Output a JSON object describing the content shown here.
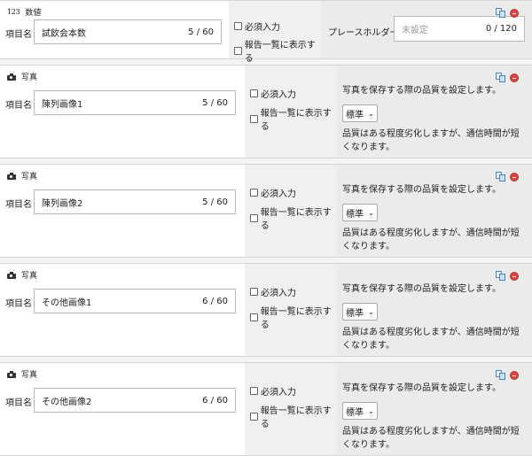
{
  "fields": [
    {
      "kind": "number",
      "type_glyph": "123",
      "type_label": "数値",
      "name_label": "項目名",
      "name_value": "試飲会本数",
      "name_count": "5 / 60",
      "required_label": "必須入力",
      "show_in_list_label": "報告一覧に表示する",
      "placeholder_label": "プレースホルダー",
      "placeholder_hint": "未設定",
      "placeholder_count": "0 / 120"
    },
    {
      "kind": "photo",
      "type_label": "写真",
      "name_label": "項目名",
      "name_value": "陳列画像1",
      "name_count": "5 / 60",
      "required_label": "必須入力",
      "show_in_list_label": "報告一覧に表示する",
      "quality_title": "写真を保存する際の品質を設定します。",
      "quality_value": "標準",
      "quality_note": "品質はある程度劣化しますが、通信時間が短くなります。"
    },
    {
      "kind": "photo",
      "type_label": "写真",
      "name_label": "項目名",
      "name_value": "陳列画像2",
      "name_count": "5 / 60",
      "required_label": "必須入力",
      "show_in_list_label": "報告一覧に表示する",
      "quality_title": "写真を保存する際の品質を設定します。",
      "quality_value": "標準",
      "quality_note": "品質はある程度劣化しますが、通信時間が短くなります。"
    },
    {
      "kind": "photo",
      "type_label": "写真",
      "name_label": "項目名",
      "name_value": "その他画像1",
      "name_count": "6 / 60",
      "required_label": "必須入力",
      "show_in_list_label": "報告一覧に表示する",
      "quality_title": "写真を保存する際の品質を設定します。",
      "quality_value": "標準",
      "quality_note": "品質はある程度劣化しますが、通信時間が短くなります。"
    },
    {
      "kind": "photo",
      "type_label": "写真",
      "name_label": "項目名",
      "name_value": "その他画像2",
      "name_count": "6 / 60",
      "required_label": "必須入力",
      "show_in_list_label": "報告一覧に表示する",
      "quality_title": "写真を保存する際の品質を設定します。",
      "quality_value": "標準",
      "quality_note": "品質はある程度劣化しますが、通信時間が短くなります。"
    }
  ],
  "icons": {
    "number": "number-icon",
    "photo": "camera-icon",
    "copy": "copy-icon",
    "delete": "delete-icon"
  },
  "colors": {
    "copy": "#4a86c8",
    "delete": "#e0443a"
  }
}
